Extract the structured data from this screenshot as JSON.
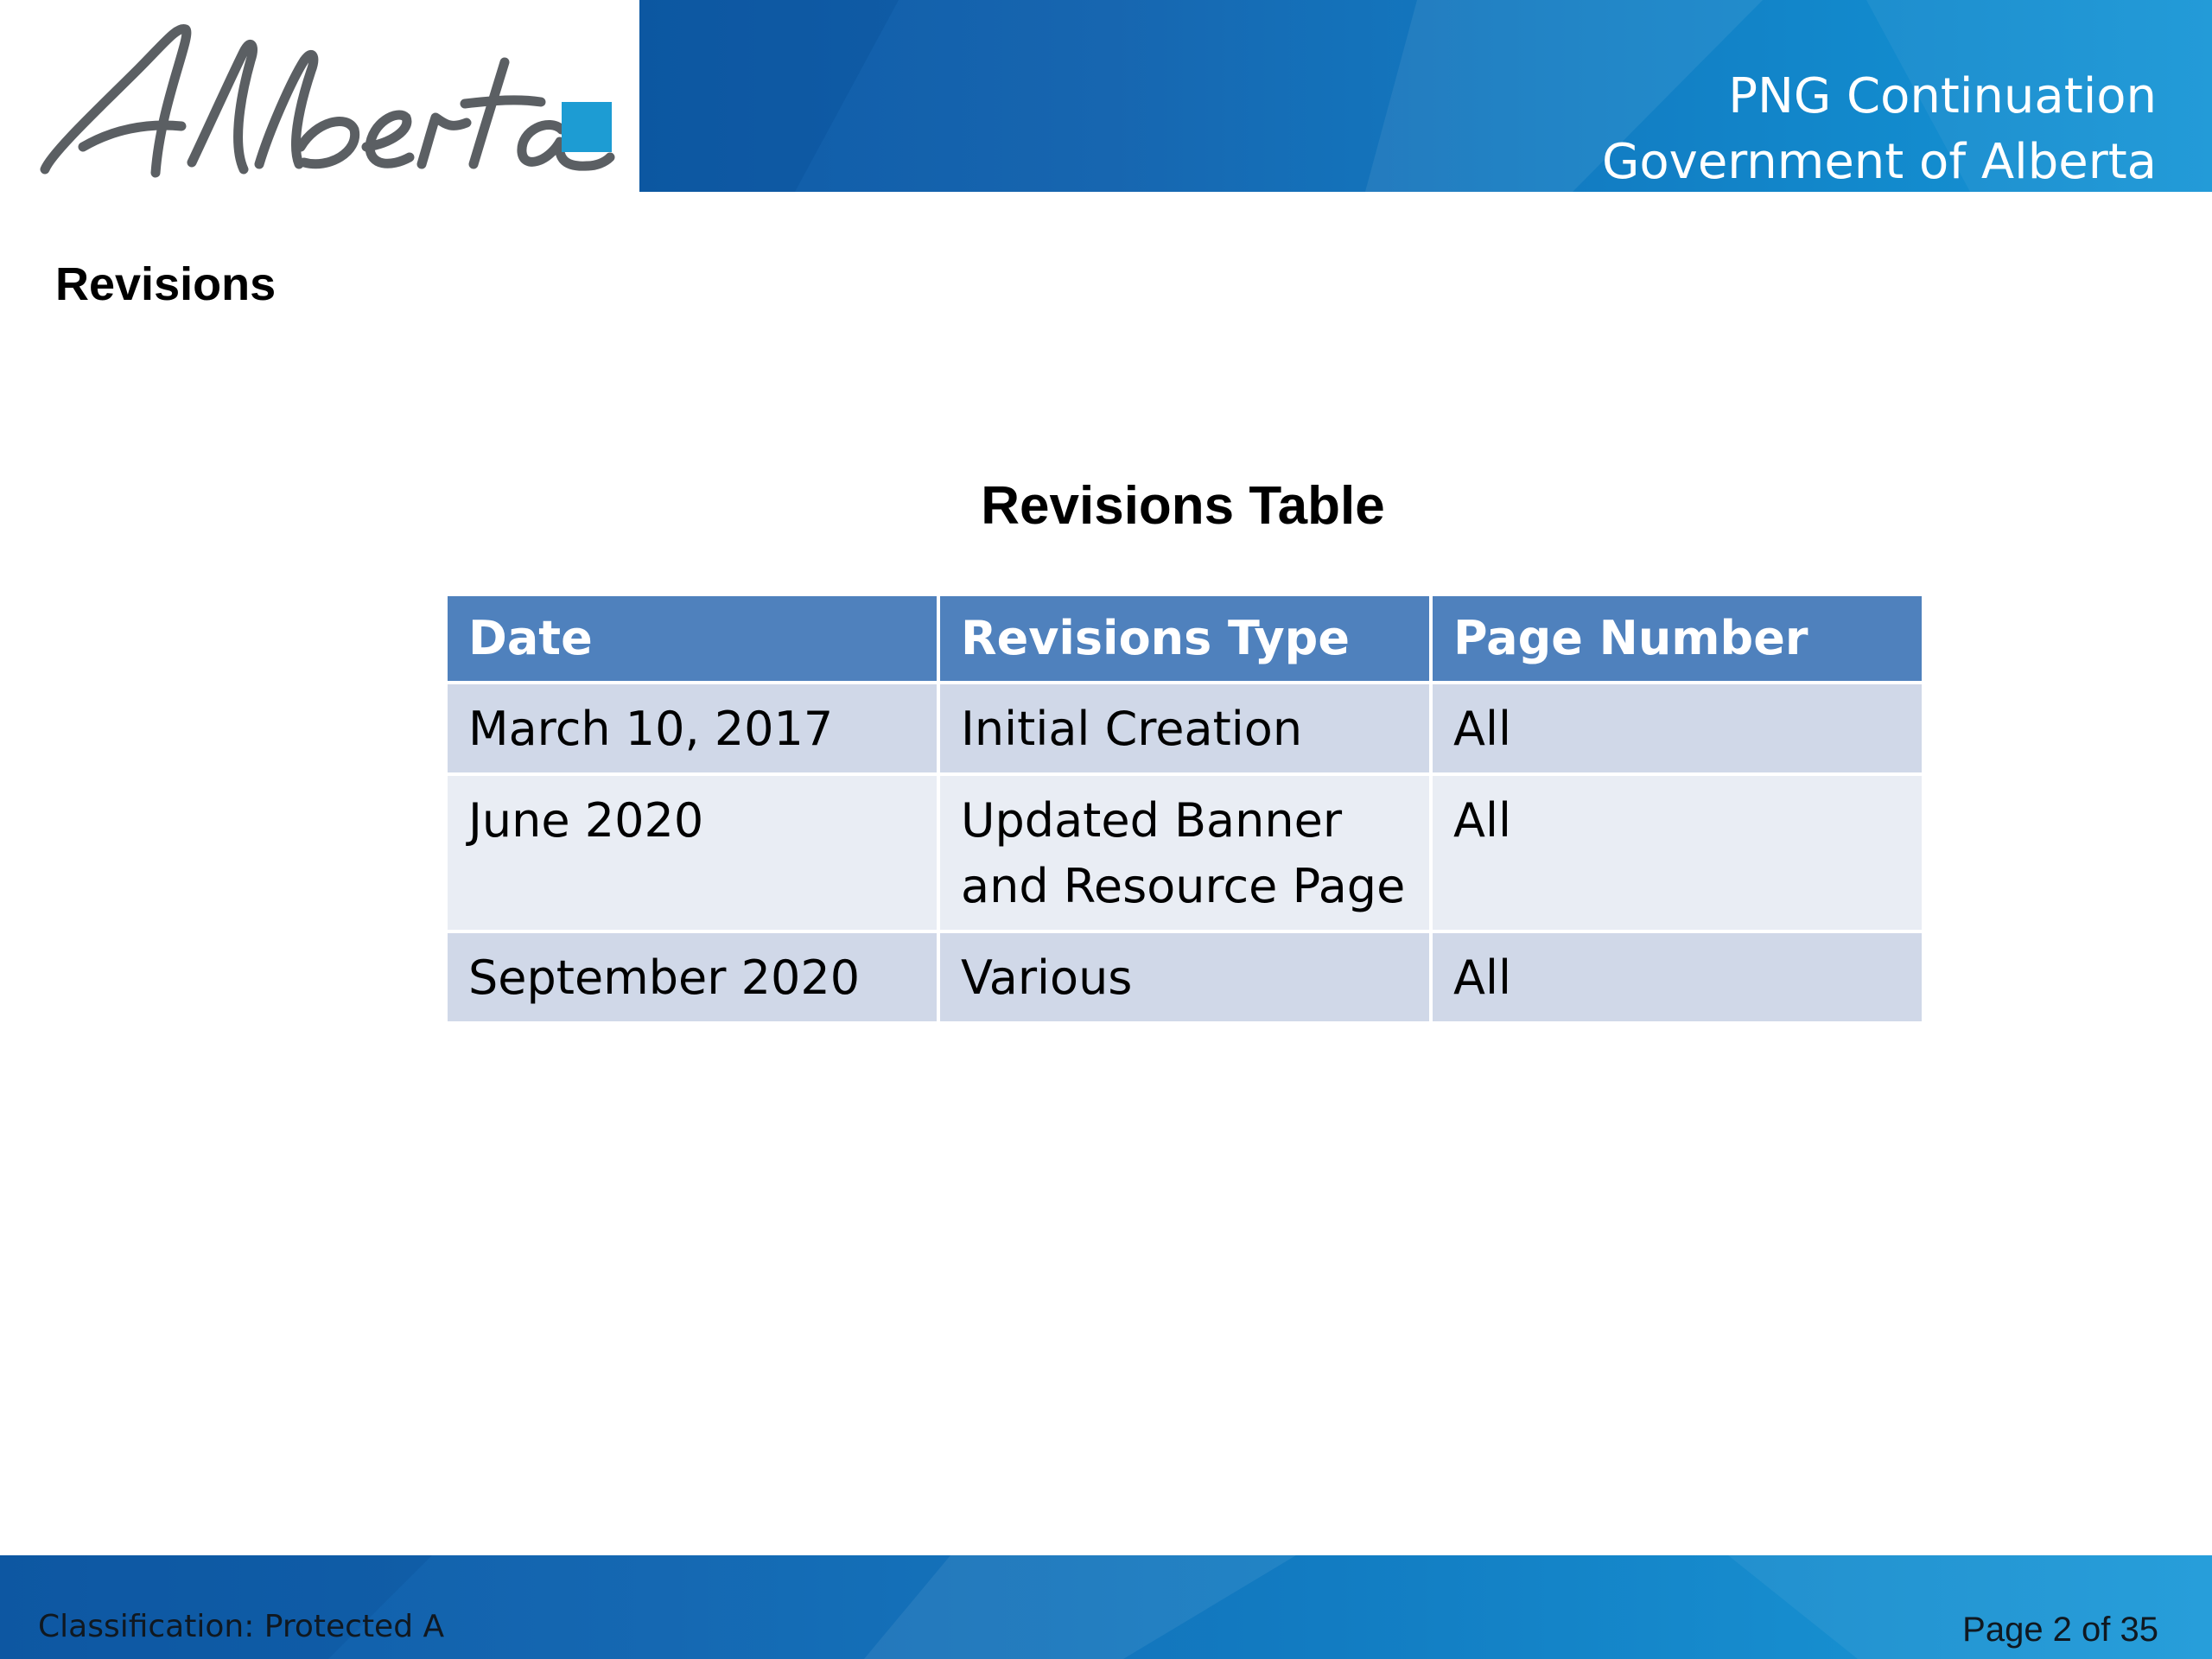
{
  "header": {
    "logo": {
      "text": "Alberta",
      "accent_color": "#1d9cd3"
    },
    "title_line1": "PNG Continuation",
    "title_line2": "Government of Alberta"
  },
  "section_heading": "Revisions",
  "revisions_table": {
    "caption": "Revisions Table",
    "columns": [
      "Date",
      "Revisions Type",
      "Page Number"
    ],
    "rows": [
      {
        "date": "March 10, 2017",
        "type": "Initial Creation",
        "page": "All"
      },
      {
        "date": "June 2020",
        "type": "Updated Banner and Resource Page",
        "page": "All"
      },
      {
        "date": "September 2020",
        "type": "Various",
        "page": "All"
      }
    ],
    "header_color": "#4f81bd",
    "row_color_odd": "#d0d8e8",
    "row_color_even": "#e9edf4"
  },
  "footer": {
    "classification": "Classification: Protected A",
    "page_label": "Page 2 of 35"
  },
  "colors": {
    "banner_dark": "#0f5ba7",
    "banner_light": "#1896d6"
  }
}
